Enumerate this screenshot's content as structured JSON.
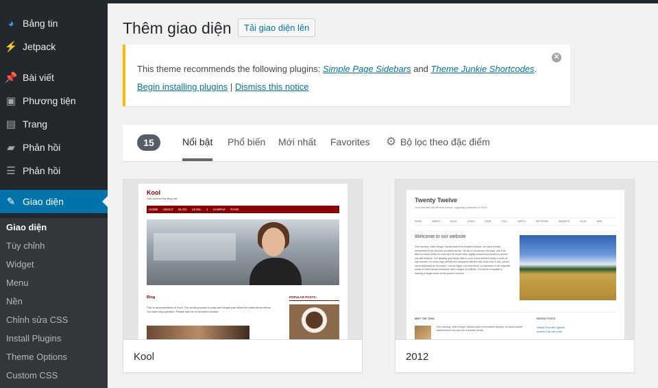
{
  "sidebar": {
    "items": [
      {
        "label": "Bảng tin",
        "icon": "dashboard-icon"
      },
      {
        "label": "Jetpack",
        "icon": "jetpack-icon"
      },
      {
        "label": "Bài viết",
        "icon": "pin-icon"
      },
      {
        "label": "Phương tiện",
        "icon": "media-icon"
      },
      {
        "label": "Trang",
        "icon": "page-icon"
      },
      {
        "label": "Phản hồi",
        "icon": "comment-icon"
      },
      {
        "label": "Phản hồi",
        "icon": "feedback-icon"
      },
      {
        "label": "Giao diện",
        "icon": "brush-icon"
      }
    ],
    "submenu": [
      "Giao diện",
      "Tùy chỉnh",
      "Widget",
      "Menu",
      "Nền",
      "Chỉnh sửa CSS",
      "Install Plugins",
      "Theme Options",
      "Custom CSS"
    ]
  },
  "header": {
    "title": "Thêm giao diện",
    "upload_label": "Tải giao diện lên"
  },
  "notice": {
    "text_prefix": "This theme recommends the following plugins: ",
    "plugin1": "Simple Page Sidebars",
    "and": " and ",
    "plugin2": "Theme Junkie Shortcodes",
    "period": ".",
    "begin_link": "Begin installing plugins",
    "separator": " | ",
    "dismiss_link": "Dismiss this notice"
  },
  "filter": {
    "count": "15",
    "tabs": [
      "Nổi bật",
      "Phổ biến",
      "Mới nhất",
      "Favorites"
    ],
    "feature_filter": "Bộ lọc theo đặc điểm"
  },
  "themes": [
    {
      "name": "Kool",
      "preview": {
        "title": "Kool",
        "tagline": "Just another My Blog site",
        "nav": "HOME ABOUT BLOG LEVEL 1 SAMPLE PAGE",
        "section": "Blog",
        "text": "This is documentation of Kool. The whole process is easy and simple just follow the instructions below. You have any question, Please ask me in comment section.",
        "sidebar_title": "POPULAR POSTS:"
      }
    },
    {
      "name": "2012",
      "preview": {
        "title": "Twenty Twelve",
        "tagline": "Your favorite WordPress theme, originally published in 2012",
        "nav": "HOME ABOUT BLOG CHILD PAGE FULL WIDTH PATTERNS WIDGETS SLUG WPA",
        "welcome": "Welcome to our website",
        "text": "One morning, when Gregor Samsa woke from troubled dreams, he found himself transformed in his bed into a horrible vermin. He lay on his armour-like back, and if he lifted his head a little he could see his brown belly, slightly domed and divided by arches into stiff sections. The bedding was hardly able to cover it and seemed ready to slide off any moment. It's many legs, pitifully thin compared with the size of the rest of him, waved about helplessly as he looked. I am so happy, my dear friend, so absorbed in the exquisite sense of mere tranquil existence, that I neglect my talents. I should be incapable of drawing a single stroke at the present moment.",
        "footer_left": "MEET THE TEAM",
        "footer_right": "RECENT POSTS",
        "footer_text": "One morning, when Gregor Samsa woke from troubled dreams, he found himself transformed in his bed into a horrible vermin.",
        "footer_links": [
          "Sample Post with Lightbox",
          "Another Post with a title"
        ]
      }
    }
  ],
  "colors": {
    "sidebar_bg": "#23282d",
    "active_bg": "#0073aa",
    "notice_border": "#ffb900",
    "link": "#0073aa"
  }
}
